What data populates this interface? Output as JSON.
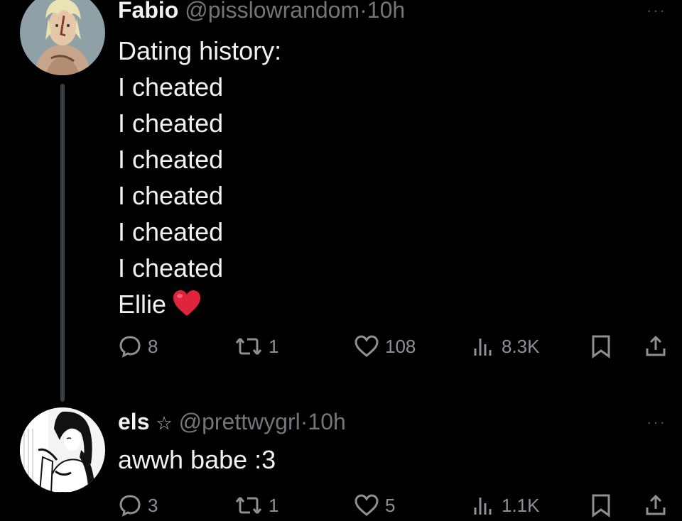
{
  "tweets": [
    {
      "author_name": "Fabio",
      "handle": "@pisslowrandom",
      "separator": "·",
      "time": "10h",
      "more_label": "···",
      "lines": [
        "Dating history:",
        "I cheated",
        "I cheated",
        "I cheated",
        "I cheated",
        "I cheated",
        "I cheated",
        "Ellie"
      ],
      "emoji": "heart-emoji",
      "avatar_icon": "anime-character-avatar",
      "stats": {
        "replies": "8",
        "reposts": "1",
        "likes": "108",
        "views": "8.3K"
      }
    },
    {
      "author_name": "els",
      "name_badge": "☆",
      "handle": "@prettwygrl",
      "separator": "·",
      "time": "10h",
      "more_label": "···",
      "lines": [
        "awwh babe :3"
      ],
      "avatar_icon": "manga-girl-avatar",
      "stats": {
        "replies": "3",
        "reposts": "1",
        "likes": "5",
        "views": "1.1K"
      }
    }
  ],
  "colors": {
    "background": "#000000",
    "text": "#e7e9ea",
    "muted": "#71767b",
    "heart": "#e0243b"
  }
}
